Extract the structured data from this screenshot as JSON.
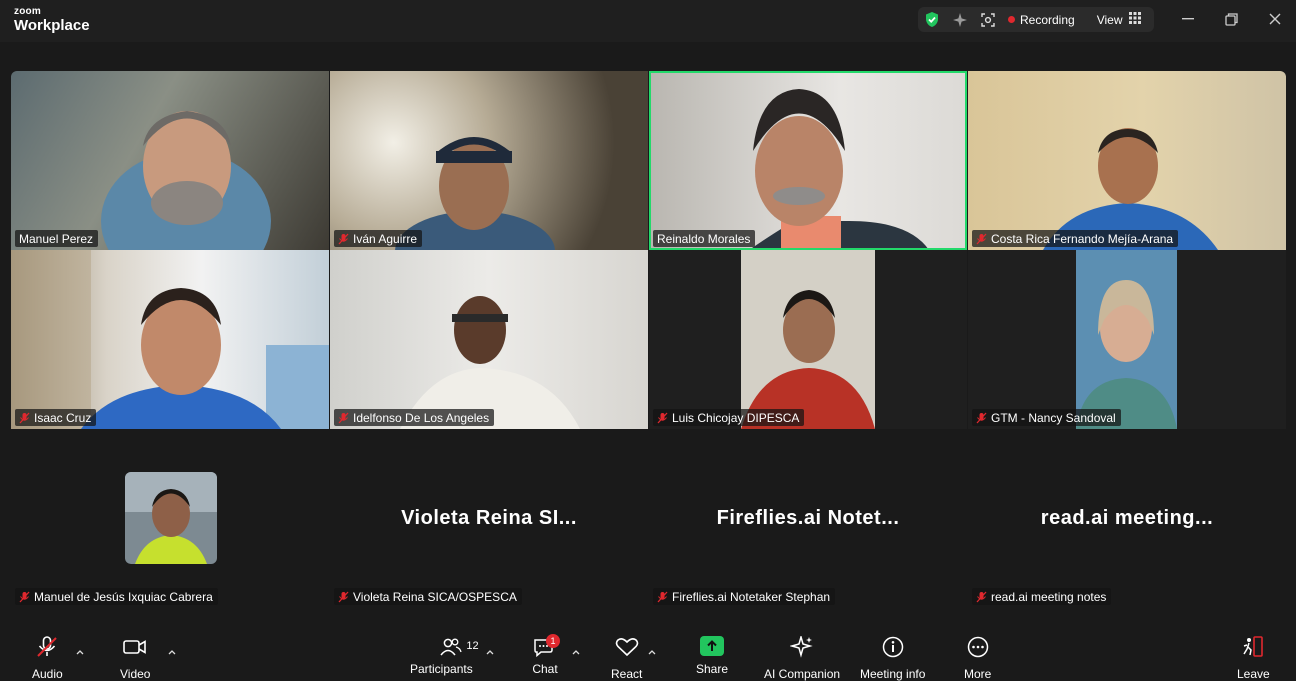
{
  "app": {
    "brand_top": "zoom",
    "brand_bottom": "Workplace"
  },
  "topbar": {
    "recording_label": "Recording",
    "view_label": "View",
    "icons": [
      "shield-check-icon",
      "sparkle-icon",
      "apps-icon",
      "grid-icon"
    ],
    "recording_color": "#e0282e"
  },
  "participants": [
    {
      "name": "Manuel Perez",
      "muted": false,
      "active": false
    },
    {
      "name": "Iván Aguirre",
      "muted": true,
      "active": false
    },
    {
      "name": "Reinaldo Morales",
      "muted": false,
      "active": true
    },
    {
      "name": "Costa Rica Fernando Mejía-Arana",
      "muted": true,
      "active": false
    },
    {
      "name": "Isaac Cruz",
      "muted": true,
      "active": false
    },
    {
      "name": "Idelfonso De Los Angeles",
      "muted": true,
      "active": false
    },
    {
      "name": "Luis Chicojay DIPESCA",
      "muted": true,
      "active": false
    },
    {
      "name": "GTM - Nancy Sandoval",
      "muted": true,
      "active": false
    },
    {
      "name": "Manuel de Jesús Ixquiac Cabrera",
      "muted": true,
      "active": false
    },
    {
      "name": "Violeta Reina SICA/OSPESCA",
      "muted": true,
      "display": "Violeta  Reina  SI..."
    },
    {
      "name": "Fireflies.ai Notetaker Stephan",
      "muted": true,
      "display": "Fireflies.ai  Notet..."
    },
    {
      "name": "read.ai meeting notes",
      "muted": true,
      "display": "read.ai  meeting..."
    }
  ],
  "toolbar": {
    "audio": "Audio",
    "video": "Video",
    "participants": "Participants",
    "participants_count": "12",
    "chat": "Chat",
    "chat_badge": "1",
    "react": "React",
    "share": "Share",
    "ai_companion": "AI Companion",
    "meeting_info": "Meeting info",
    "more": "More",
    "leave": "Leave",
    "accent": "#22c55e",
    "alert": "#e0282e"
  }
}
